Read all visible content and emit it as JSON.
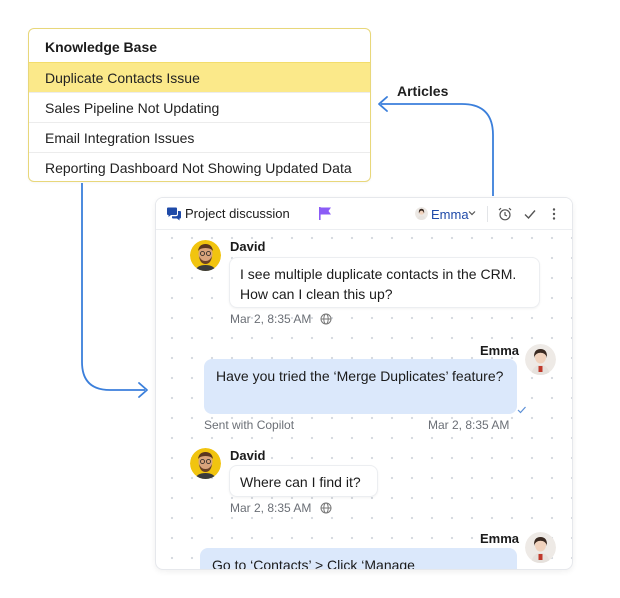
{
  "knowledge_base": {
    "title": "Knowledge Base",
    "items": [
      {
        "label": "Duplicate Contacts Issue",
        "active": true
      },
      {
        "label": "Sales Pipeline Not Updating"
      },
      {
        "label": "Email Integration Issues"
      },
      {
        "label": "Reporting Dashboard Not Showing Updated Data"
      }
    ]
  },
  "connector": {
    "label": "Articles",
    "color": "#3b7fdb"
  },
  "chat": {
    "title": "Project discussion",
    "assignee": "Emma",
    "flag_color": "#8b5cf6",
    "messages": [
      {
        "sender": "David",
        "text": "I see multiple duplicate contacts in the CRM. How can I clean this up?",
        "time": "Mar 2, 8:35 AM"
      },
      {
        "sender": "Emma",
        "text": "Have you tried the ‘Merge Duplicates’ feature?",
        "note": "Sent with Copilot",
        "time": "Mar 2, 8:35 AM"
      },
      {
        "sender": "David",
        "text": "Where can I find it?",
        "time": "Mar 2, 8:35 AM"
      },
      {
        "sender": "Emma",
        "text": "Go to ‘Contacts’ > Click ‘Manage"
      }
    ]
  },
  "colors": {
    "highlight": "#fbe98a",
    "outgoing_bubble": "#dbe8fb",
    "accent": "#1f4aa8"
  }
}
